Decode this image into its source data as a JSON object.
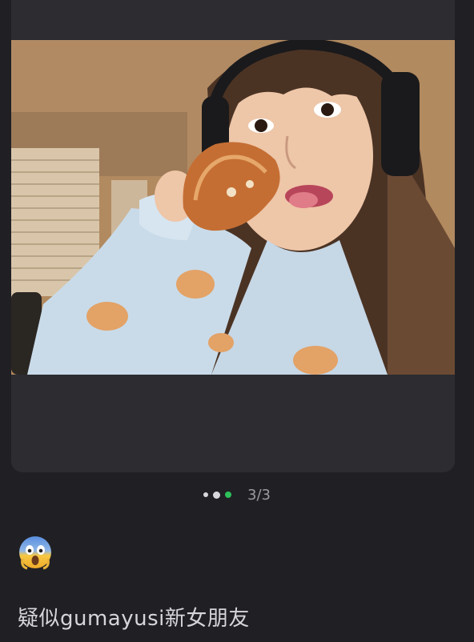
{
  "post": {
    "caption": "疑似gumayusi新女朋友",
    "emoji_icon": "screaming-in-fear-emoji"
  },
  "gallery": {
    "counter": "3/3",
    "total": 3,
    "current": 3,
    "active_color": "#2ec05a"
  },
  "colors": {
    "background": "#202024",
    "card": "#2c2c31"
  }
}
